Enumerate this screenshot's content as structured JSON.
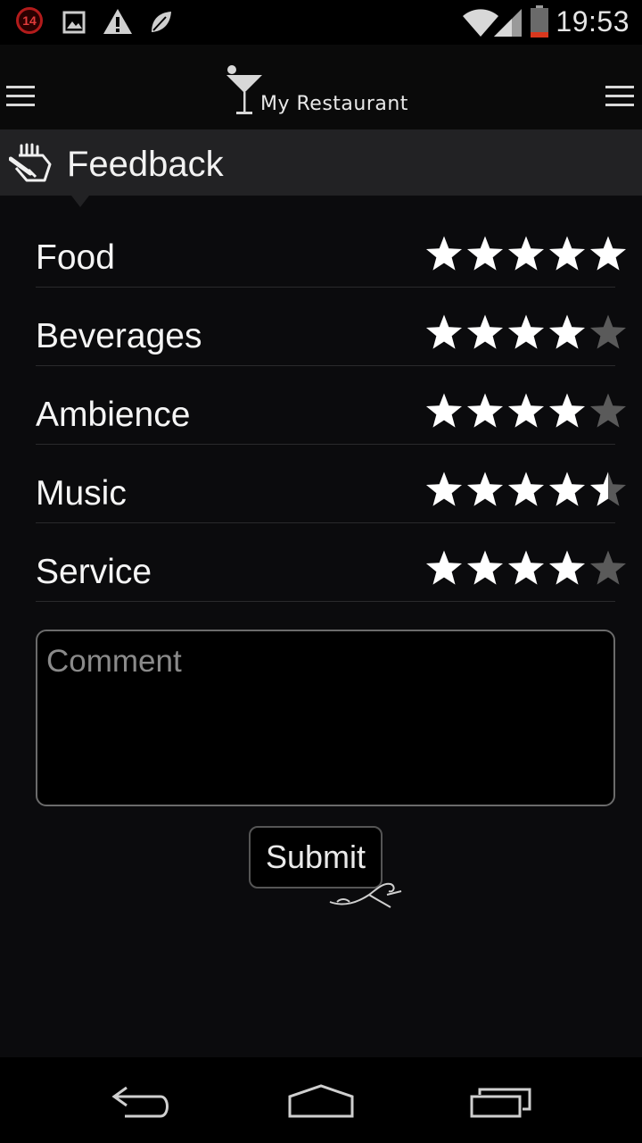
{
  "status_bar": {
    "notification_count": "14",
    "time": "19:53",
    "icons": [
      "notification-count-icon",
      "image-icon",
      "warning-icon",
      "leaf-icon",
      "wifi-icon",
      "cell-signal-icon",
      "battery-icon"
    ]
  },
  "action_bar": {
    "app_name": "My Restaurant",
    "left_menu_icon": "hamburger-icon",
    "right_menu_icon": "hamburger-icon",
    "logo_icon": "cocktail-glass-icon"
  },
  "section": {
    "title": "Feedback",
    "icon": "feedback-hand-icon"
  },
  "ratings": [
    {
      "label": "Food",
      "value": 5,
      "max": 5
    },
    {
      "label": "Beverages",
      "value": 4,
      "max": 5
    },
    {
      "label": "Ambience",
      "value": 4,
      "max": 5
    },
    {
      "label": "Music",
      "value": 4.5,
      "max": 5
    },
    {
      "label": "Service",
      "value": 4,
      "max": 5
    }
  ],
  "comment": {
    "placeholder": "Comment",
    "value": ""
  },
  "submit": {
    "label": "Submit"
  },
  "colors": {
    "background": "#0b0b0d",
    "star_filled": "#ffffff",
    "star_empty": "#5a5a5a",
    "section_header": "#222224",
    "notification_badge": "#b21b1b",
    "battery_low": "#d9381e"
  },
  "nav_bar": {
    "icons": [
      "back-icon",
      "home-icon",
      "recent-apps-icon"
    ]
  }
}
